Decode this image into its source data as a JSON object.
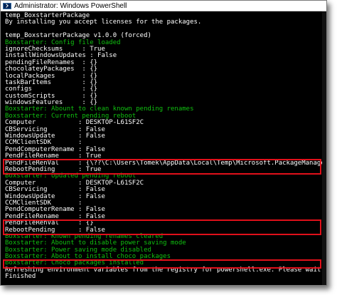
{
  "window": {
    "title": "Administrator: Windows PowerShell",
    "icon": "powershell-icon",
    "highlight_color": "#e0101a",
    "text_color": "#ffffff",
    "info_color": "#10c010"
  },
  "console_lines": [
    {
      "text": "temp_BoxstarterPackage",
      "color": "white"
    },
    {
      "text": "By installing you accept licenses for the packages.",
      "color": "white"
    },
    {
      "text": "",
      "color": "white"
    },
    {
      "text": "temp_BoxstarterPackage v1.0.0 (forced)",
      "color": "white"
    },
    {
      "text": "Boxstarter: Config file loaded",
      "color": "green"
    },
    {
      "text": "ignoreChecksums     : True",
      "color": "white"
    },
    {
      "text": "installWindowsUpdates : False",
      "color": "white"
    },
    {
      "text": "pendingFileRenames  : {}",
      "color": "white"
    },
    {
      "text": "chocolateyPackages  : {}",
      "color": "white"
    },
    {
      "text": "localPackages       : {}",
      "color": "white"
    },
    {
      "text": "taskBarItems        : {}",
      "color": "white"
    },
    {
      "text": "configs             : {}",
      "color": "white"
    },
    {
      "text": "customScripts       : {}",
      "color": "white"
    },
    {
      "text": "windowsFeatures     : {}",
      "color": "white"
    },
    {
      "text": "Boxstarter: Abount to clean known pending renames",
      "color": "green"
    },
    {
      "text": "Boxstarter: Current pending reboot",
      "color": "green"
    },
    {
      "text": "Computer           : DESKTOP-L61SF2C",
      "color": "white"
    },
    {
      "text": "CBServicing        : False",
      "color": "white"
    },
    {
      "text": "WindowsUpdate      : False",
      "color": "white"
    },
    {
      "text": "CCMClientSDK       :",
      "color": "white"
    },
    {
      "text": "PendComputerRename : False",
      "color": "white"
    },
    {
      "text": "PendFileRename     : True",
      "color": "white"
    },
    {
      "text": "PendFileRenVal     : {\\??\\C:\\Users\\Tomek\\AppData\\Local\\Temp\\Microsoft.PackageManagement\\28, }",
      "color": "white"
    },
    {
      "text": "RebootPending      : True",
      "color": "white"
    },
    {
      "text": "Boxstarter: Updated pending reboot",
      "color": "green"
    },
    {
      "text": "Computer           : DESKTOP-L61SF2C",
      "color": "white"
    },
    {
      "text": "CBServicing        : False",
      "color": "white"
    },
    {
      "text": "WindowsUpdate      : False",
      "color": "white"
    },
    {
      "text": "CCMClientSDK       :",
      "color": "white"
    },
    {
      "text": "PendComputerRename : False",
      "color": "white"
    },
    {
      "text": "PendFileRename     : False",
      "color": "white"
    },
    {
      "text": "PendFileRenVal     : {}",
      "color": "white"
    },
    {
      "text": "RebootPending      : False",
      "color": "white"
    },
    {
      "text": "Boxstarter: Known pending renames cleared",
      "color": "green"
    },
    {
      "text": "Boxstarter: Abount to disable power saving mode",
      "color": "green"
    },
    {
      "text": "Boxstarter: Power saving mode disabled",
      "color": "green"
    },
    {
      "text": "Boxstarter: About to install choco packages",
      "color": "green"
    },
    {
      "text": "Boxstarter: Choco packages installed",
      "color": "green"
    },
    {
      "text": "Refreshing environment variables from the registry for powershell.exe. Please wait...",
      "color": "white"
    },
    {
      "text": "Finished",
      "color": "white"
    }
  ],
  "highlight_groups": [
    {
      "name": "pending-file-rename-before",
      "lines": [
        22,
        23
      ]
    },
    {
      "name": "pending-file-rename-after",
      "lines": [
        31,
        32
      ]
    },
    {
      "name": "choco-installed",
      "lines": [
        37,
        37
      ]
    }
  ]
}
